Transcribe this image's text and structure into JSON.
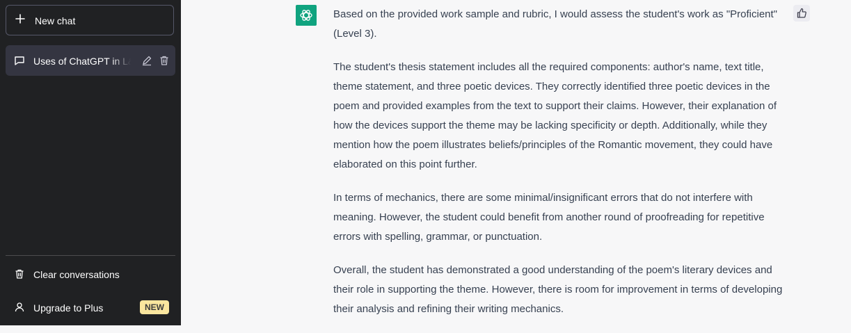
{
  "sidebar": {
    "new_chat_label": "New chat",
    "chat_title": "Uses of ChatGPT in L&",
    "clear_label": "Clear conversations",
    "upgrade_label": "Upgrade to Plus",
    "new_badge": "NEW"
  },
  "icons": {
    "new_chat": "plus-icon",
    "chat": "message-icon",
    "edit": "pencil-icon",
    "delete": "trash-icon",
    "clear": "trash-icon",
    "upgrade": "user-icon",
    "avatar": "openai-logo-icon",
    "feedback": "thumbs-up-icon"
  },
  "colors": {
    "sidebar_bg": "#202123",
    "active_item_bg": "#343541",
    "avatar_bg": "#10a37f",
    "badge_bg": "#fae69e",
    "main_bg": "#f7f7f8"
  },
  "message": {
    "paragraphs": [
      "Based on the provided work sample and rubric, I would assess the student's work as \"Proficient\" (Level 3).",
      "The student's thesis statement includes all the required components: author's name, text title, theme statement, and three poetic devices. They correctly identified three poetic devices in the poem and provided examples from the text to support their claims. However, their explanation of how the devices support the theme may be lacking specificity or depth. Additionally, while they mention how the poem illustrates beliefs/principles of the Romantic movement, they could have elaborated on this point further.",
      "In terms of mechanics, there are some minimal/insignificant errors that do not interfere with meaning. However, the student could benefit from another round of proofreading for repetitive errors with spelling, grammar, or punctuation.",
      "Overall, the student has demonstrated a good understanding of the poem's literary devices and their role in supporting the theme. However, there is room for improvement in terms of developing their analysis and refining their writing mechanics."
    ]
  }
}
